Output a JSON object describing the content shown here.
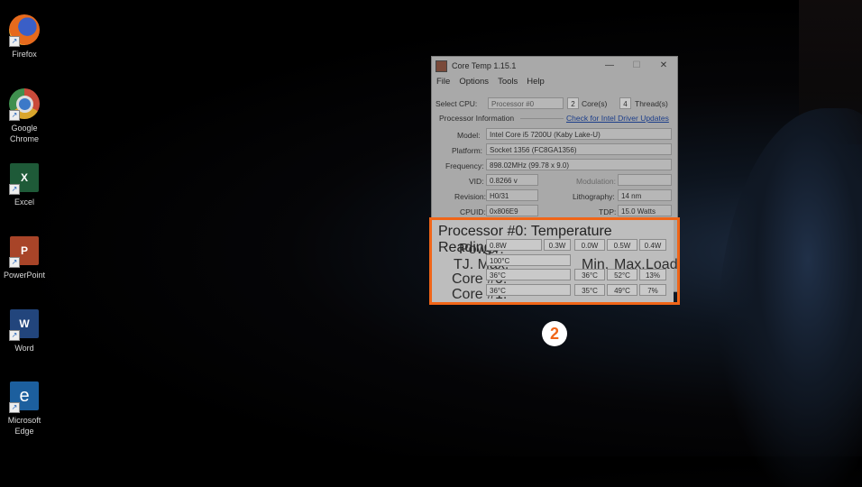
{
  "desktop": {
    "icons": [
      {
        "label": "Firefox",
        "icon": "firefox-icon",
        "color": "#e66a1d"
      },
      {
        "label": "Google\nChrome",
        "icon": "chrome-icon",
        "color": "#3f8f4e"
      },
      {
        "label": "Excel",
        "icon": "excel-icon",
        "color": "#1e5a38",
        "letter": "X"
      },
      {
        "label": "PowerPoint",
        "icon": "powerpoint-icon",
        "color": "#a84428",
        "letter": "P"
      },
      {
        "label": "Word",
        "icon": "word-icon",
        "color": "#22457c",
        "letter": "W"
      },
      {
        "label": "Microsoft\nEdge",
        "icon": "edge-icon",
        "color": "#1c5f9e",
        "letter": "e"
      }
    ]
  },
  "window": {
    "title": "Core Temp 1.15.1",
    "controls": {
      "minimize": "—",
      "maximize": "☐",
      "close": "✕"
    },
    "menu": [
      "File",
      "Options",
      "Tools",
      "Help"
    ],
    "select_cpu_label": "Select CPU:",
    "cpu_selected": "Processor #0",
    "cores_value": "2",
    "cores_label": "Core(s)",
    "threads_value": "4",
    "threads_label": "Thread(s)",
    "processor_info_label": "Processor Information",
    "driver_link": "Check for Intel Driver Updates",
    "model_label": "Model:",
    "model_value": "Intel Core i5 7200U (Kaby Lake-U)",
    "platform_label": "Platform:",
    "platform_value": "Socket 1356 (FC8GA1356)",
    "frequency_label": "Frequency:",
    "frequency_value": "898.02MHz (99.78 x 9.0)",
    "vid_label": "VID:",
    "vid_value": "0.8266 v",
    "modulation_label": "Modulation:",
    "modulation_value": "",
    "revision_label": "Revision:",
    "revision_value": "H0/31",
    "lithography_label": "Lithography:",
    "lithography_value": "14 nm",
    "cpuid_label": "CPUID:",
    "cpuid_value": "0x806E9",
    "tdp_label": "TDP:",
    "tdp_value": "15.0 Watts"
  },
  "temps": {
    "heading": "Processor #0: Temperature Readings",
    "power_label": "Power:",
    "power_values": [
      "0.8W",
      "0.3W",
      "0.0W",
      "0.5W",
      "0.4W"
    ],
    "tjmax_label": "TJ. Max:",
    "tjmax_value": "100°C",
    "col_headers": [
      "Min.",
      "Max.",
      "Load"
    ],
    "cores": [
      {
        "label": "Core #0:",
        "current": "36°C",
        "min": "36°C",
        "max": "52°C",
        "load": "13%"
      },
      {
        "label": "Core #1:",
        "current": "36°C",
        "min": "35°C",
        "max": "49°C",
        "load": "7%"
      }
    ]
  },
  "callout": {
    "number": "2",
    "color": "#f06518"
  }
}
